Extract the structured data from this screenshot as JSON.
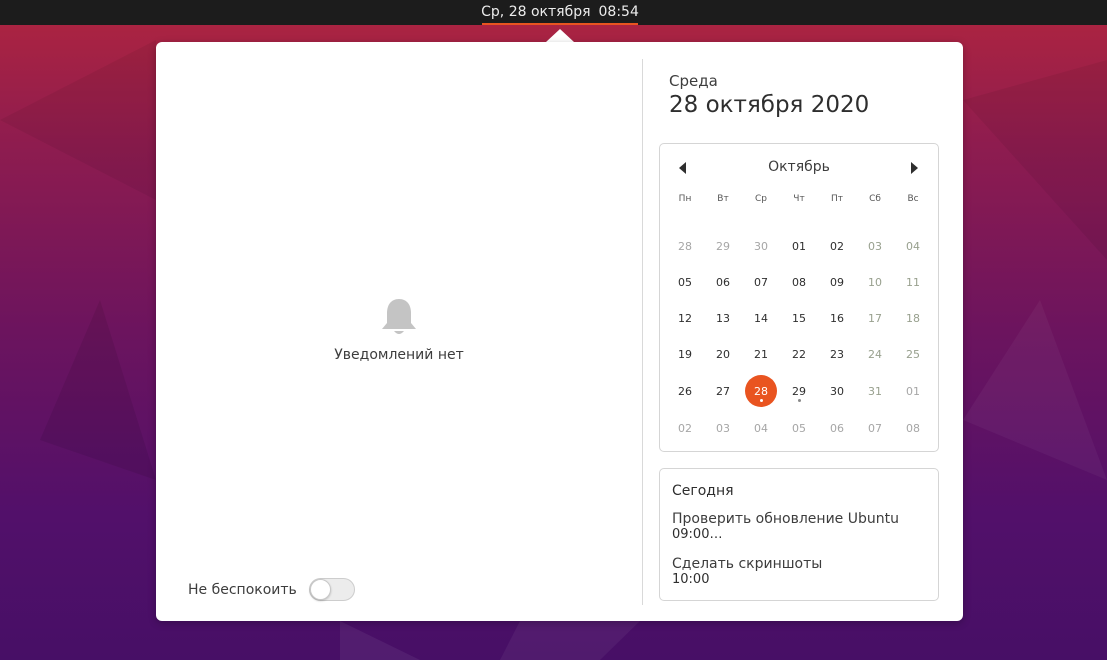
{
  "topbar": {
    "date": "Ср, 28 октября",
    "time": "08:54"
  },
  "notifications": {
    "empty_label": "Уведомлений нет",
    "dnd_label": "Не беспокоить",
    "dnd_enabled": false
  },
  "date_header": {
    "weekday": "Среда",
    "full_date": "28 октября 2020"
  },
  "calendar": {
    "month": "Октябрь",
    "weekdays": [
      "Пн",
      "Вт",
      "Ср",
      "Чт",
      "Пт",
      "Сб",
      "Вс"
    ],
    "weeks": [
      [
        "28",
        "29",
        "30",
        "01",
        "02",
        "03",
        "04"
      ],
      [
        "05",
        "06",
        "07",
        "08",
        "09",
        "10",
        "11"
      ],
      [
        "12",
        "13",
        "14",
        "15",
        "16",
        "17",
        "18"
      ],
      [
        "19",
        "20",
        "21",
        "22",
        "23",
        "24",
        "25"
      ],
      [
        "26",
        "27",
        "28",
        "29",
        "30",
        "31",
        "01"
      ],
      [
        "02",
        "03",
        "04",
        "05",
        "06",
        "07",
        "08"
      ]
    ],
    "today": "28",
    "event_days": [
      "28",
      "29"
    ]
  },
  "events": {
    "heading": "Сегодня",
    "items": [
      {
        "title": "Проверить обновление Ubuntu",
        "time": "09:00…"
      },
      {
        "title": "Сделать скриншоты",
        "time": "10:00"
      }
    ]
  },
  "colors": {
    "accent": "#e95420",
    "panel": "#1c1c1c"
  },
  "icons": {
    "bell": "bell-icon",
    "prev": "chevron-left-icon",
    "next": "chevron-right-icon"
  }
}
